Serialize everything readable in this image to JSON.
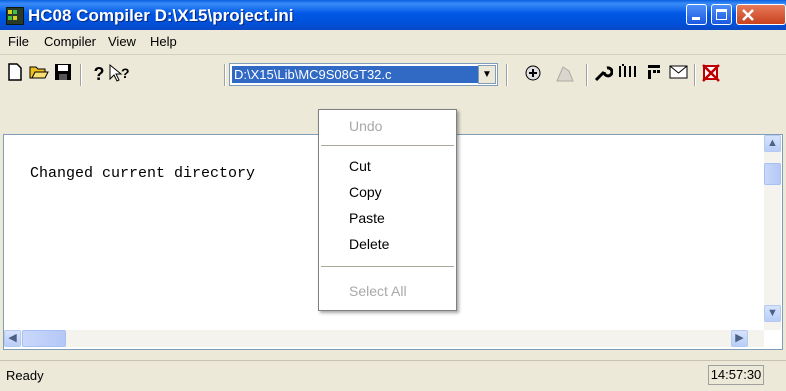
{
  "window": {
    "title": "HC08 Compiler  D:\\X15\\project.ini"
  },
  "menu": {
    "items": [
      "File",
      "Compiler",
      "View",
      "Help"
    ]
  },
  "toolbar": {
    "path_value": "D:\\X15\\Lib\\MC9S08GT32.c",
    "dropdown_arrow": "▼"
  },
  "output": {
    "text": "Changed current directory"
  },
  "context_menu": {
    "undo": "Undo",
    "cut": "Cut",
    "copy": "Copy",
    "paste": "Paste",
    "delete": "Delete",
    "select_all": "Select All"
  },
  "status": {
    "text": "Ready",
    "time": "14:57:30"
  },
  "icons": {
    "new": "new-file-icon",
    "open": "open-folder-icon",
    "save": "save-disk-icon",
    "help": "help-icon",
    "context_help": "context-help-icon",
    "compile": "compile-icon",
    "stop": "stop-icon",
    "options": "options-wrench-icon",
    "message_settings": "message-settings-icon",
    "standard_types": "standard-types-icon",
    "mail": "mail-icon",
    "error": "error-icon"
  },
  "colors": {
    "titlebar": "#0058e6",
    "selection": "#316ac5",
    "disabled_text": "#a8a8a8"
  }
}
